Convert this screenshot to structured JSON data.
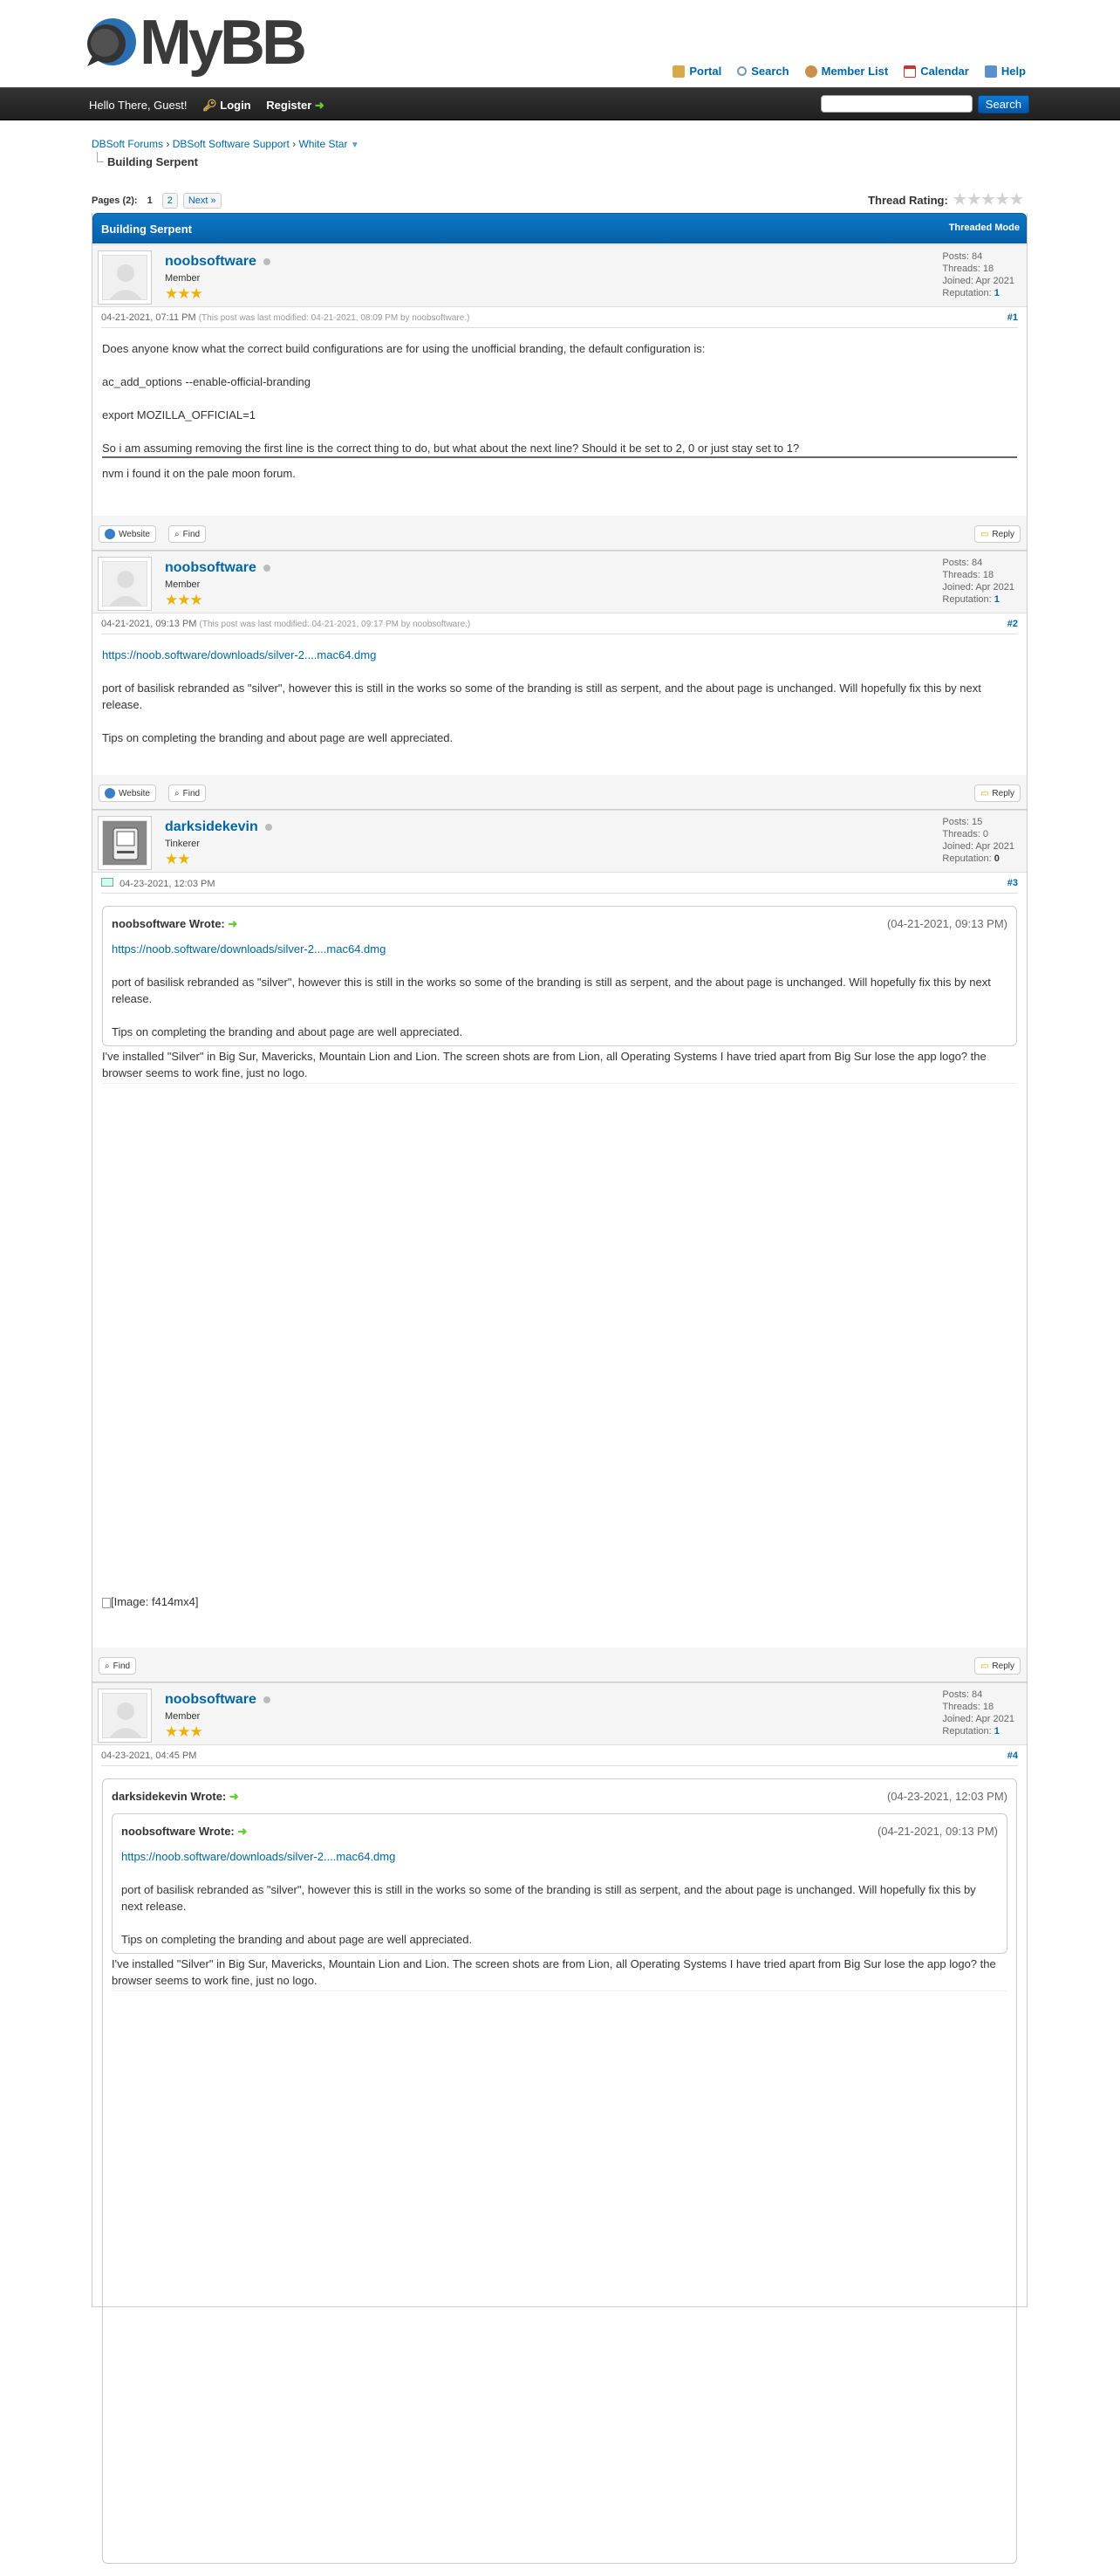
{
  "header": {
    "logo_text": "MyBB"
  },
  "toplinks": [
    {
      "label": "Portal",
      "icon": "portal-icon"
    },
    {
      "label": "Search",
      "icon": "search-icon"
    },
    {
      "label": "Member List",
      "icon": "members-icon"
    },
    {
      "label": "Calendar",
      "icon": "calendar-icon"
    },
    {
      "label": "Help",
      "icon": "help-icon"
    }
  ],
  "panel": {
    "welcome": "Hello There, Guest!",
    "login": "Login",
    "register": "Register",
    "search_button": "Search"
  },
  "breadcrumb": {
    "items": [
      "DBSoft Forums",
      "DBSoft Software Support",
      "White Star"
    ],
    "current": "Building Serpent"
  },
  "pagination": {
    "label": "Pages (2):",
    "current": "1",
    "page2": "2",
    "next": "Next »"
  },
  "rating": {
    "label": "Thread Rating:"
  },
  "thread": {
    "title": "Building Serpent",
    "mode": "Threaded Mode"
  },
  "buttons": {
    "website": "Website",
    "find": "Find",
    "reply": "Reply"
  },
  "posts": [
    {
      "author": "noobsoftware",
      "title": "Member",
      "stats": {
        "posts": "Posts: 84",
        "threads": "Threads: 18",
        "joined": "Joined: Apr 2021",
        "rep_label": "Reputation:",
        "rep": "1"
      },
      "date": "04-21-2021, 07:11 PM",
      "edit": "(This post was last modified: 04-21-2021, 08:09 PM by noobsoftware.)",
      "num": "#1",
      "lines": [
        "Does anyone know what the correct build configurations are for using the unofficial branding, the default configuration is:",
        "ac_add_options --enable-official-branding",
        "export MOZILLA_OFFICIAL=1",
        "So i am assuming removing the first line is the correct thing to do, but what about the next line? Should it be set to 2, 0 or just stay set to 1?"
      ],
      "after": "nvm i found it on the pale moon forum."
    },
    {
      "author": "noobsoftware",
      "title": "Member",
      "stats": {
        "posts": "Posts: 84",
        "threads": "Threads: 18",
        "joined": "Joined: Apr 2021",
        "rep_label": "Reputation:",
        "rep": "1"
      },
      "date": "04-21-2021, 09:13 PM",
      "edit": "(This post was last modified: 04-21-2021, 09:17 PM by noobsoftware.)",
      "num": "#2",
      "link": "https://noob.software/downloads/silver-2....mac64.dmg",
      "lines": [
        "port of basilisk rebranded as \"silver\", however this is still in the works so some of the branding is still as serpent, and the about page is unchanged. Will hopefully fix this by next release.",
        "Tips on completing the branding and about page are well appreciated."
      ]
    },
    {
      "author": "darksidekevin",
      "title": "Tinkerer",
      "stats": {
        "posts": "Posts: 15",
        "threads": "Threads: 0",
        "joined": "Joined: Apr 2021",
        "rep_label": "Reputation:",
        "rep": "0"
      },
      "date": "04-23-2021, 12:03 PM",
      "num": "#3",
      "quote": {
        "who": "noobsoftware Wrote:",
        "date": "(04-21-2021, 09:13 PM)"
      },
      "reply": "I've installed \"Silver\" in Big Sur, Mavericks, Mountain Lion and Lion. The screen shots are from Lion, all Operating Systems I have tried  apart from Big Sur lose the app logo? the browser seems to work fine, just no logo.",
      "image_alt": "[Image: f414mx4]"
    },
    {
      "author": "noobsoftware",
      "title": "Member",
      "stats": {
        "posts": "Posts: 84",
        "threads": "Threads: 18",
        "joined": "Joined: Apr 2021",
        "rep_label": "Reputation:",
        "rep": "1"
      },
      "date": "04-23-2021, 04:45 PM",
      "num": "#4",
      "quote": {
        "who": "darksidekevin Wrote:",
        "date": "(04-23-2021, 12:03 PM)"
      },
      "inner_quote": {
        "who": "noobsoftware Wrote:",
        "date": "(04-21-2021, 09:13 PM)"
      }
    }
  ]
}
